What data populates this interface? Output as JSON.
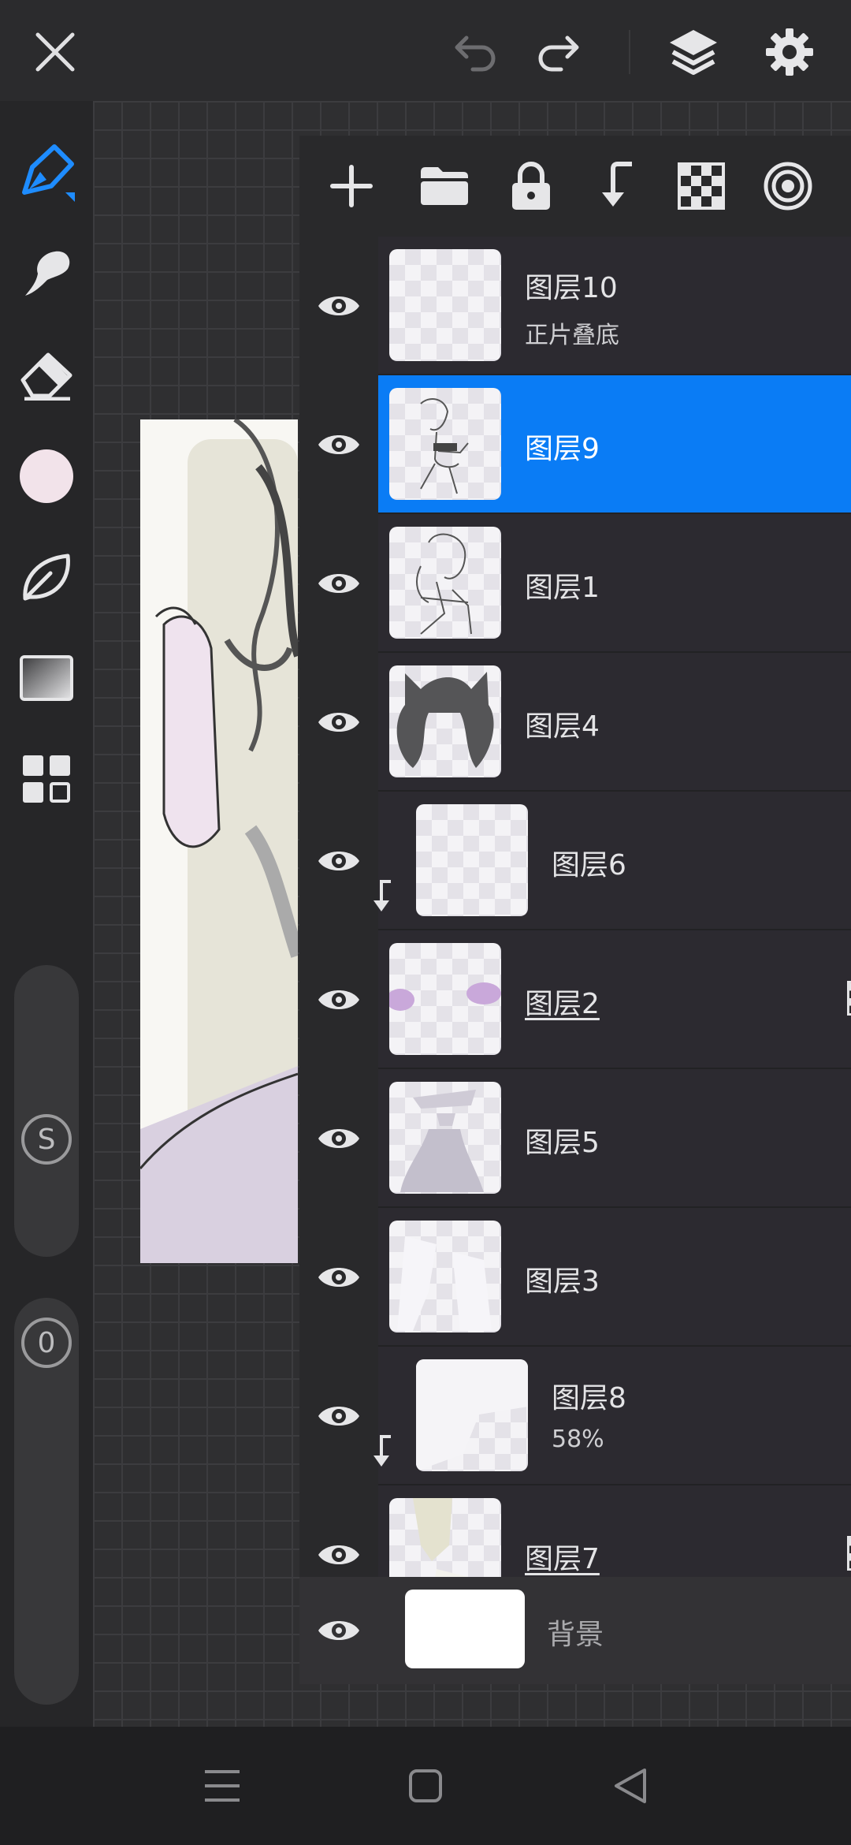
{
  "layers": [
    {
      "name": "图层10",
      "sub": "正片叠底",
      "selected": false,
      "clipped": false,
      "alpha_lock": false,
      "underline": false
    },
    {
      "name": "图层9",
      "sub": "",
      "selected": true,
      "clipped": false,
      "alpha_lock": false,
      "underline": false
    },
    {
      "name": "图层1",
      "sub": "",
      "selected": false,
      "clipped": false,
      "alpha_lock": false,
      "underline": false
    },
    {
      "name": "图层4",
      "sub": "",
      "selected": false,
      "clipped": false,
      "alpha_lock": false,
      "underline": false
    },
    {
      "name": "图层6",
      "sub": "",
      "selected": false,
      "clipped": true,
      "alpha_lock": false,
      "underline": false
    },
    {
      "name": "图层2",
      "sub": "",
      "selected": false,
      "clipped": false,
      "alpha_lock": true,
      "underline": true
    },
    {
      "name": "图层5",
      "sub": "",
      "selected": false,
      "clipped": false,
      "alpha_lock": false,
      "underline": false
    },
    {
      "name": "图层3",
      "sub": "",
      "selected": false,
      "clipped": false,
      "alpha_lock": false,
      "underline": false
    },
    {
      "name": "图层8",
      "sub": "58%",
      "selected": false,
      "clipped": true,
      "alpha_lock": false,
      "underline": false
    },
    {
      "name": "图层7",
      "sub": "",
      "selected": false,
      "clipped": false,
      "alpha_lock": true,
      "underline": true
    }
  ],
  "background_layer": {
    "name": "背景"
  },
  "sliders": {
    "size_label": "S",
    "opacity_label": "0"
  },
  "colors": {
    "accent": "#0a7cf5",
    "current_color": "#f2e3ea",
    "panel": "#29292b"
  },
  "icons": {
    "top": [
      "close-icon",
      "undo-icon",
      "redo-icon",
      "layers-icon",
      "settings-icon"
    ],
    "left": [
      "pen-icon",
      "smudge-icon",
      "eraser-icon",
      "color-swatch",
      "leaf-icon",
      "gradient-icon",
      "grid-menu-icon"
    ],
    "panel": [
      "add-layer-icon",
      "folder-icon",
      "lock-icon",
      "merge-down-icon",
      "alpha-lock-icon",
      "blend-icon"
    ],
    "nav": [
      "menu-icon",
      "home-icon",
      "back-icon"
    ]
  }
}
